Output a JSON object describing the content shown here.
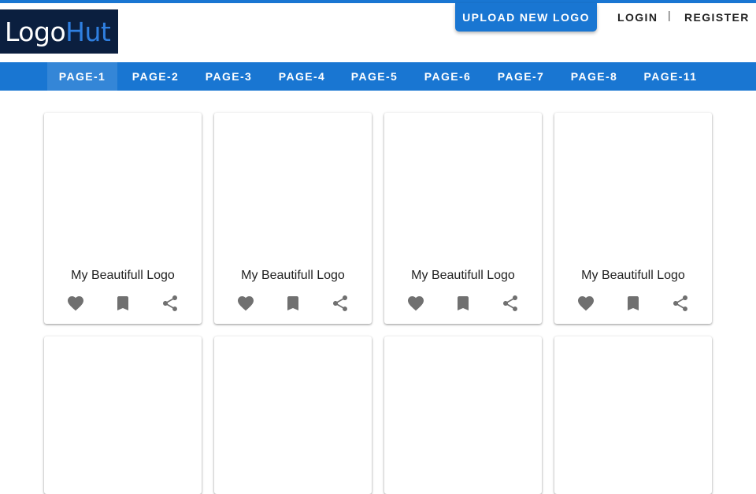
{
  "brand": {
    "logo_part1": "Logo",
    "logo_part2": "Hut"
  },
  "header": {
    "upload_label": "UPLOAD NEW LOGO",
    "login_label": "LOGIN",
    "separator": "|",
    "register_label": "REGISTER"
  },
  "nav": {
    "active_index": 0,
    "items": [
      "PAGE-1",
      "PAGE-2",
      "PAGE-3",
      "PAGE-4",
      "PAGE-5",
      "PAGE-6",
      "PAGE-7",
      "PAGE-8",
      "PAGE-11"
    ]
  },
  "cards": [
    {
      "title": "My Beautifull Logo"
    },
    {
      "title": "My Beautifull Logo"
    },
    {
      "title": "My Beautifull Logo"
    },
    {
      "title": "My Beautifull Logo"
    },
    {
      "title": ""
    },
    {
      "title": ""
    },
    {
      "title": ""
    },
    {
      "title": ""
    }
  ],
  "card_actions": [
    "heart-icon",
    "bookmark-icon",
    "share-icon"
  ],
  "colors": {
    "primary": "#1976d2",
    "logo_bg": "#0b1f3f",
    "logo_accent": "#2f7fe0",
    "icon": "#707070"
  }
}
